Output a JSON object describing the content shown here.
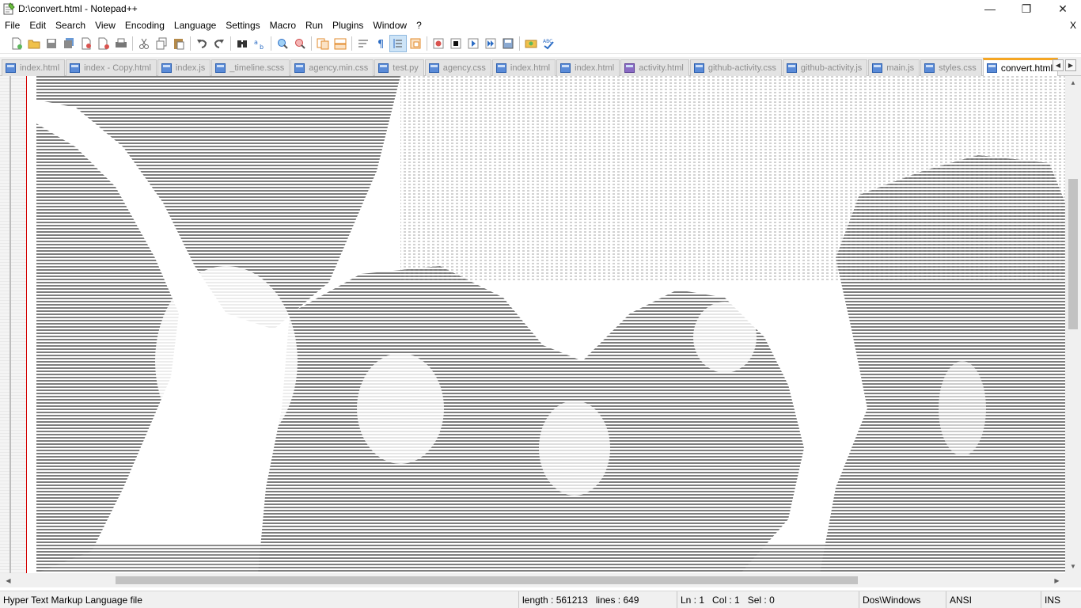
{
  "window": {
    "title": "D:\\convert.html - Notepad++",
    "minimize_glyph": "—",
    "restore_glyph": "❐",
    "close_glyph": "✕"
  },
  "menu": {
    "items": [
      "File",
      "Edit",
      "Search",
      "View",
      "Encoding",
      "Language",
      "Settings",
      "Macro",
      "Run",
      "Plugins",
      "Window",
      "?"
    ],
    "close_doc": "X"
  },
  "toolbar": {
    "icons": [
      "new-file-icon",
      "open-file-icon",
      "save-icon",
      "save-all-icon",
      "close-icon",
      "close-all-icon",
      "print-icon",
      "cut-icon",
      "copy-icon",
      "paste-icon",
      "undo-icon",
      "redo-icon",
      "find-icon",
      "replace-icon",
      "zoom-in-icon",
      "zoom-out-icon",
      "sync-vertical-icon",
      "sync-horizontal-icon",
      "word-wrap-icon",
      "show-all-chars-icon",
      "indent-guide-icon",
      "doc-map-icon",
      "record-macro-icon",
      "stop-macro-icon",
      "play-macro-icon",
      "run-macro-multiple-icon",
      "save-macro-icon",
      "launch-browser-icon",
      "spell-check-icon"
    ]
  },
  "tabs": [
    {
      "label": "index.html",
      "active": false
    },
    {
      "label": "index - Copy.html",
      "active": false
    },
    {
      "label": "index.js",
      "active": false
    },
    {
      "label": "_timeline.scss",
      "active": false
    },
    {
      "label": "agency.min.css",
      "active": false
    },
    {
      "label": "test.py",
      "active": false
    },
    {
      "label": "agency.css",
      "active": false
    },
    {
      "label": "index.html",
      "active": false
    },
    {
      "label": "index.html",
      "active": false
    },
    {
      "label": "activity.html",
      "active": false
    },
    {
      "label": "github-activity.css",
      "active": false
    },
    {
      "label": "github-activity.js",
      "active": false
    },
    {
      "label": "main.js",
      "active": false
    },
    {
      "label": "styles.css",
      "active": false
    },
    {
      "label": "convert.html",
      "active": true
    }
  ],
  "tab_nav": {
    "prev": "◀",
    "next": "▶"
  },
  "scroll": {
    "up": "▲",
    "down": "▼",
    "left": "◀",
    "right": "▶"
  },
  "status": {
    "file_type": "Hyper Text Markup Language file",
    "length": "length : 561213",
    "lines": "lines : 649",
    "ln": "Ln : 1",
    "col": "Col : 1",
    "sel": "Sel : 0",
    "eol": "Dos\\Windows",
    "encoding": "ANSI",
    "mode": "INS"
  },
  "colors": {
    "accent_tab": "#f5a623",
    "edge_line": "#d40000",
    "ascii_dark": "#7d7d7d"
  }
}
